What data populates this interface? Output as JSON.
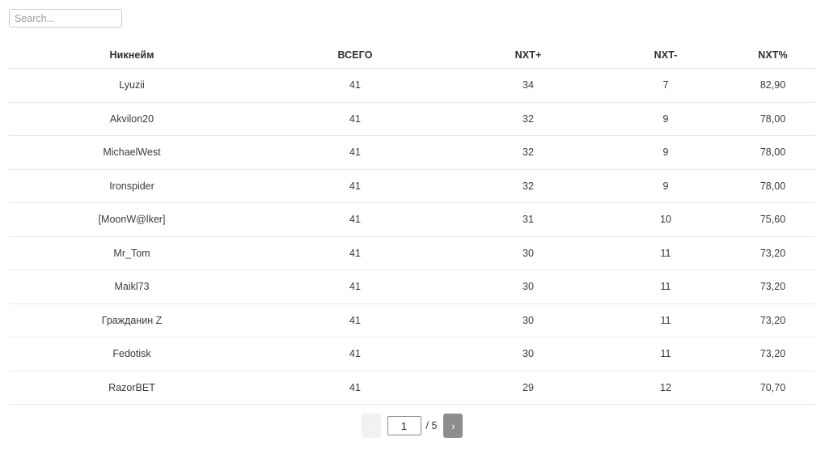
{
  "search": {
    "placeholder": "Search...",
    "value": ""
  },
  "table": {
    "columns": [
      {
        "key": "nickname",
        "label": "Никнейм"
      },
      {
        "key": "total",
        "label": "ВСЕГО"
      },
      {
        "key": "nxt_plus",
        "label": "NXT+"
      },
      {
        "key": "nxt_minus",
        "label": "NXT-"
      },
      {
        "key": "nxt_pct",
        "label": "NXT%"
      }
    ],
    "rows": [
      {
        "nickname": "Lyuzii",
        "total": "41",
        "nxt_plus": "34",
        "nxt_minus": "7",
        "nxt_pct": "82,90"
      },
      {
        "nickname": "Akvilon20",
        "total": "41",
        "nxt_plus": "32",
        "nxt_minus": "9",
        "nxt_pct": "78,00"
      },
      {
        "nickname": "MichaelWest",
        "total": "41",
        "nxt_plus": "32",
        "nxt_minus": "9",
        "nxt_pct": "78,00"
      },
      {
        "nickname": "Ironspider",
        "total": "41",
        "nxt_plus": "32",
        "nxt_minus": "9",
        "nxt_pct": "78,00"
      },
      {
        "nickname": "[MoonW@lker]",
        "total": "41",
        "nxt_plus": "31",
        "nxt_minus": "10",
        "nxt_pct": "75,60"
      },
      {
        "nickname": "Mr_Tom",
        "total": "41",
        "nxt_plus": "30",
        "nxt_minus": "11",
        "nxt_pct": "73,20"
      },
      {
        "nickname": "Maikl73",
        "total": "41",
        "nxt_plus": "30",
        "nxt_minus": "11",
        "nxt_pct": "73,20"
      },
      {
        "nickname": "Гражданин Z",
        "total": "41",
        "nxt_plus": "30",
        "nxt_minus": "11",
        "nxt_pct": "73,20"
      },
      {
        "nickname": "Fedotisk",
        "total": "41",
        "nxt_plus": "30",
        "nxt_minus": "11",
        "nxt_pct": "73,20"
      },
      {
        "nickname": "RazorBET",
        "total": "41",
        "nxt_plus": "29",
        "nxt_minus": "12",
        "nxt_pct": "70,70"
      }
    ]
  },
  "pagination": {
    "prev_label": "‹",
    "next_label": "›",
    "current_page": "1",
    "total_pages_label": "/ 5",
    "total_pages": "5",
    "prev_disabled": true
  },
  "colors": {
    "text": "#333333",
    "header_text": "#2e2e2e",
    "row_border": "#e8e8e8",
    "input_border": "#cccccc",
    "pager_next_bg": "#8d8d8d",
    "pager_prev_bg": "#f1f1f1",
    "background": "#ffffff"
  }
}
